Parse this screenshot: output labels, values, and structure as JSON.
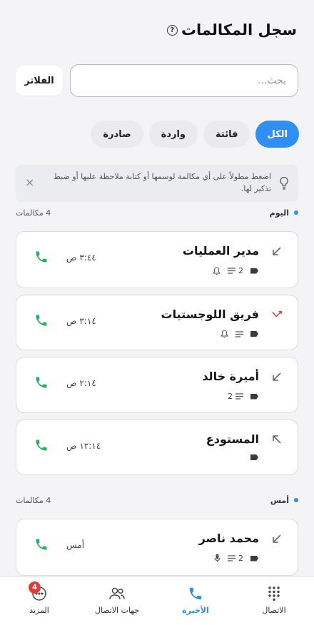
{
  "header": {
    "title": "سجل المكالمات",
    "help_icon": "?"
  },
  "search": {
    "placeholder": "بحث...",
    "value": ""
  },
  "filter": {
    "label": "الفلاتر"
  },
  "tabs": [
    {
      "label": "الكل",
      "active": true
    },
    {
      "label": "فائتة",
      "active": false
    },
    {
      "label": "واردة",
      "active": false
    },
    {
      "label": "صادرة",
      "active": false
    }
  ],
  "tip": {
    "text": "اضغط مطولاً على أي مكالمة لوسمها أو كتابة ملاحظة عليها أو ضبط تذكير لها.",
    "close": "×"
  },
  "sections": {
    "today": {
      "label": "اليوم",
      "count": "4 مكالمات"
    },
    "yesterday": {
      "label": "أمس",
      "count": "4 مكالمات"
    }
  },
  "calls": [
    {
      "name": "مدير العمليات",
      "time": "٣:٤٤ ص",
      "direction": "incoming",
      "notes": "2",
      "icons": [
        "tag-icon",
        "notes-icon",
        "bell-icon"
      ]
    },
    {
      "name": "فريق اللوجستيات",
      "time": "٣:١٤ ص",
      "direction": "missed",
      "icons": [
        "tag-icon",
        "notes-icon",
        "bell-icon"
      ]
    },
    {
      "name": "أميرة خالد",
      "time": "٢:١٤ ص",
      "direction": "incoming",
      "notes": "2",
      "icons": [
        "tag-icon",
        "notes-icon"
      ]
    },
    {
      "name": "المستودع",
      "time": "١٢:١٤ ص",
      "direction": "outgoing",
      "icons": [
        "tag-icon"
      ]
    },
    {
      "name": "محمد ناصر",
      "time": "أمس",
      "direction": "incoming",
      "notes": "2",
      "icons": [
        "tag-icon",
        "notes-icon",
        "mic-icon"
      ]
    }
  ],
  "nav": [
    {
      "label": "الاتصال",
      "icon": "dialpad-icon",
      "active": false
    },
    {
      "label": "الأخيرة",
      "icon": "phone-icon",
      "active": true
    },
    {
      "label": "جهات الاتصال",
      "icon": "contacts-icon",
      "active": false
    },
    {
      "label": "المزيد",
      "icon": "more-icon",
      "badge": "4",
      "active": false
    }
  ],
  "colors": {
    "accent": "#2f8ff4",
    "call_green": "#1fb35b",
    "missed_red": "#e53935"
  }
}
